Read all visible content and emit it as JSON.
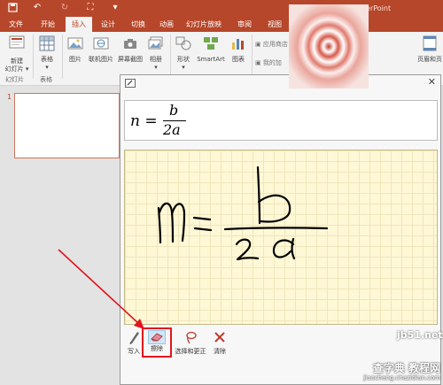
{
  "window": {
    "title": "演示文稿1 - PowerPoint"
  },
  "tabs": [
    "文件",
    "开始",
    "插入",
    "设计",
    "切换",
    "动画",
    "幻灯片放映",
    "审阅",
    "视图"
  ],
  "active_tab": "插入",
  "ribbon": {
    "new_slide_line1": "新建",
    "new_slide_line2": "幻灯片",
    "table": "表格",
    "picture": "图片",
    "online_picture": "联机图片",
    "screenshot": "屏幕截图",
    "album": "相册",
    "shapes": "形状",
    "smartart": "SmartArt",
    "chart": "图表",
    "app_store": "应用商店",
    "my_addins": "我的加",
    "header_footer": "页眉和页",
    "group_slides": "幻灯片",
    "group_tables": "表格"
  },
  "slide_panel": {
    "slide_number": "1"
  },
  "math_input": {
    "preview_lhs": "n =",
    "preview_numerator": "b",
    "preview_denominator": "2a",
    "tools": {
      "write": "写入",
      "erase": "擦除",
      "select_correct": "选择和更正",
      "clear": "清除"
    }
  },
  "watermark": {
    "line1": "查字典 教程网",
    "line2": "jiaocheng.chazidian.com",
    "site": "jb51.net"
  }
}
